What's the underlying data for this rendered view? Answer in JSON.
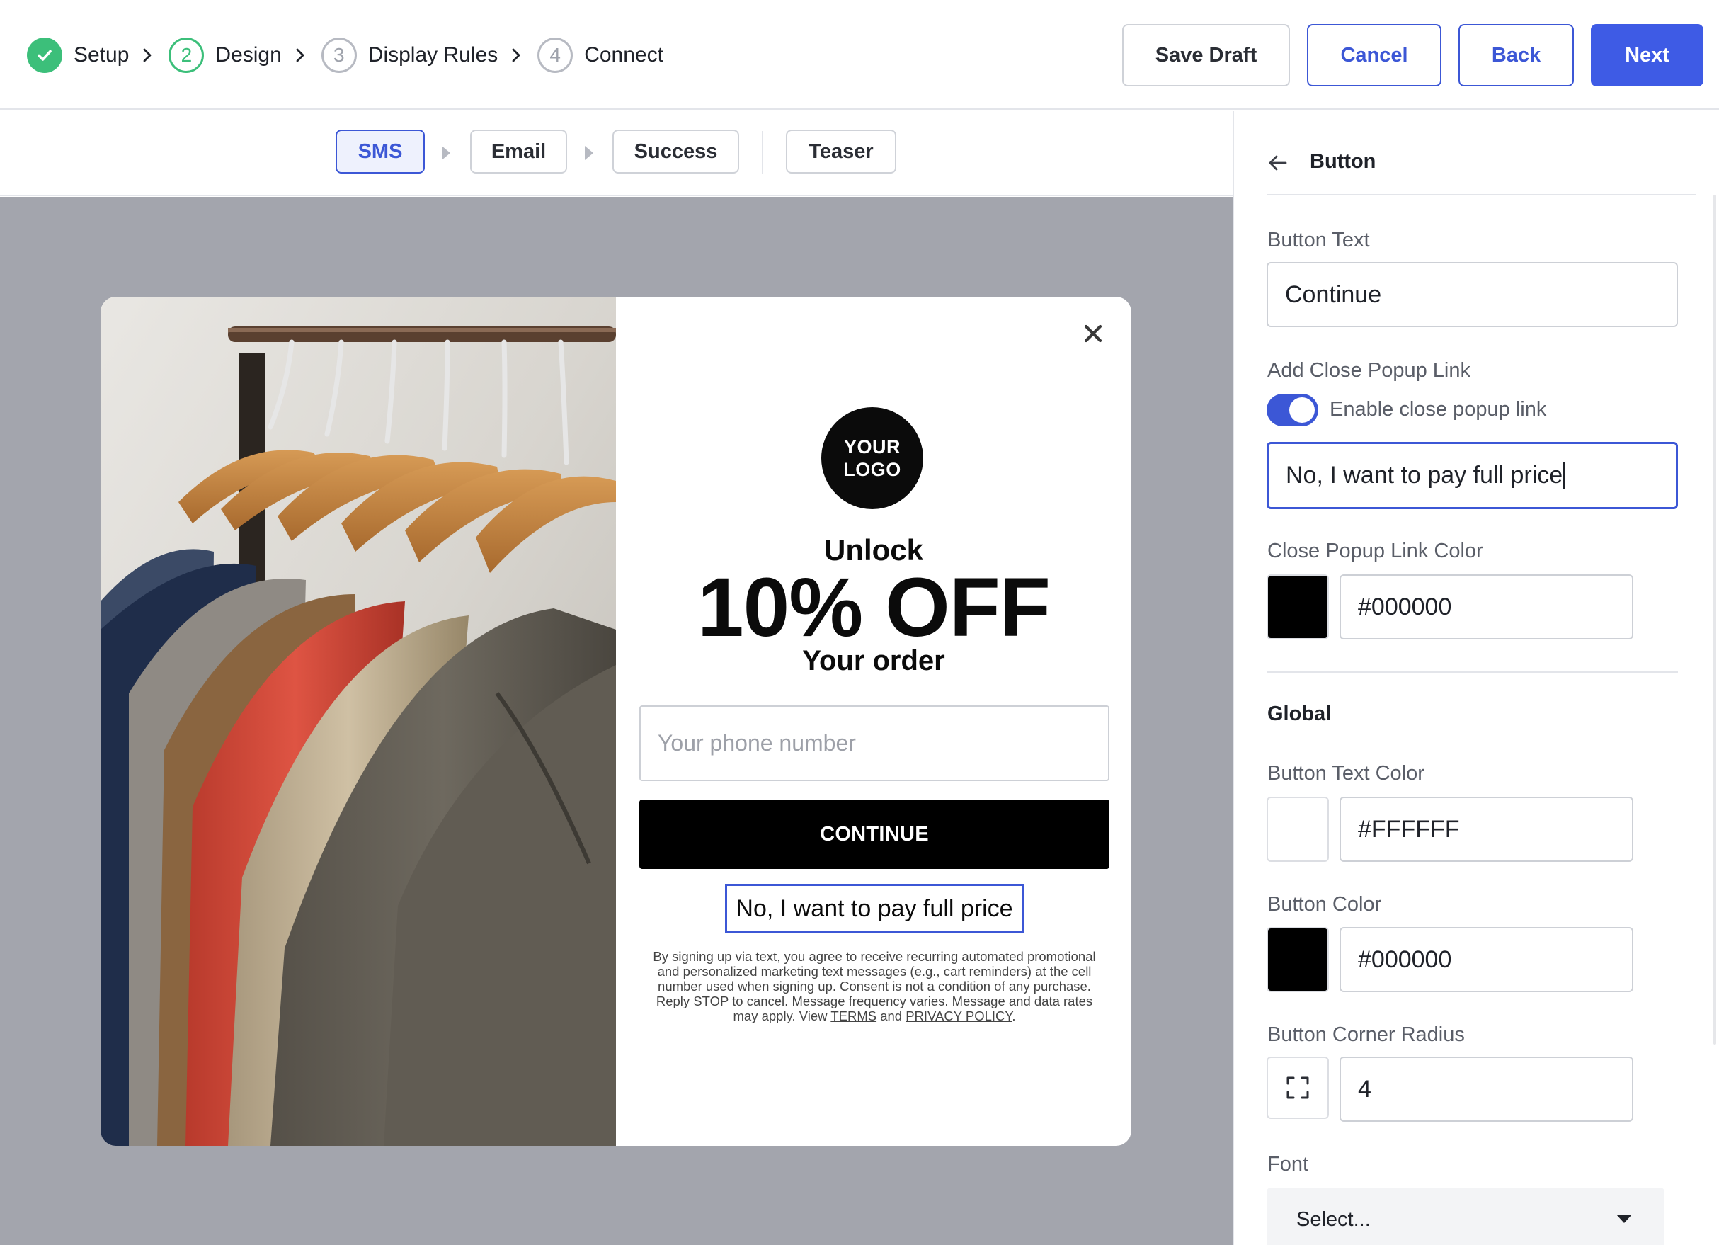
{
  "stepper": {
    "steps": [
      {
        "number": "",
        "label": "Setup",
        "state": "done"
      },
      {
        "number": "2",
        "label": "Design",
        "state": "current"
      },
      {
        "number": "3",
        "label": "Display Rules",
        "state": "todo"
      },
      {
        "number": "4",
        "label": "Connect",
        "state": "todo"
      }
    ]
  },
  "toolbar": {
    "save_draft": "Save Draft",
    "cancel": "Cancel",
    "back": "Back",
    "next": "Next"
  },
  "subtabs": {
    "sms": "SMS",
    "email": "Email",
    "success": "Success",
    "teaser": "Teaser",
    "active": "SMS"
  },
  "popup": {
    "logo_line1": "YOUR",
    "logo_line2": "LOGO",
    "headline_top": "Unlock",
    "headline_big": "10% OFF",
    "headline_bottom": "Your order",
    "phone_placeholder": "Your phone number",
    "continue_label": "CONTINUE",
    "close_link_text": "No, I want to pay full price",
    "disclaimer_text": "By signing up via text, you agree to receive recurring automated promotional and personalized marketing text messages (e.g., cart reminders) at the cell number used when signing up. Consent is not a condition of any purchase. Reply STOP to cancel. Message frequency varies. Message and data rates may apply. View ",
    "terms_link": "TERMS",
    "and_text": " and ",
    "privacy_link": "PRIVACY POLICY",
    "period": "."
  },
  "panel": {
    "title": "Button",
    "button_text_label": "Button Text",
    "button_text_value": "Continue",
    "close_link_section_label": "Add Close Popup Link",
    "toggle_label": "Enable close popup link",
    "toggle_on": true,
    "close_link_value": "No, I want to pay full price",
    "close_link_color_label": "Close Popup Link Color",
    "close_link_color_value": "#000000",
    "global_title": "Global",
    "button_text_color_label": "Button Text Color",
    "button_text_color_value": "#FFFFFF",
    "button_color_label": "Button Color",
    "button_color_value": "#000000",
    "corner_radius_label": "Button Corner Radius",
    "corner_radius_value": "4",
    "font_label": "Font",
    "font_placeholder": "Select..."
  },
  "colors": {
    "accent": "#3c57d6",
    "next_button": "#3e5be5",
    "success_green": "#3cbf7a",
    "canvas_bg": "#a3a5ad"
  },
  "icons": [
    "check-icon",
    "chevron-right-icon",
    "arrow-left-icon",
    "close-icon",
    "corner-radius-icon",
    "caret-down-icon"
  ]
}
